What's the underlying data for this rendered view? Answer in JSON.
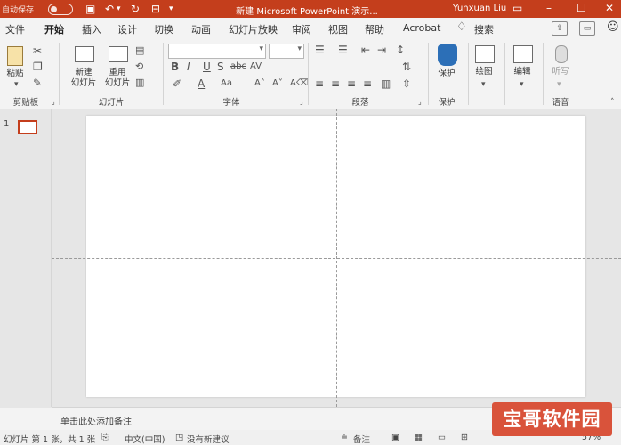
{
  "titlebar": {
    "autosave": "自动保存",
    "autosave_state": "关",
    "title": "新建 Microsoft PowerPoint 演示...",
    "user": "Yunxuan Liu"
  },
  "tabs": [
    "文件",
    "开始",
    "插入",
    "设计",
    "切换",
    "动画",
    "幻灯片放映",
    "审阅",
    "视图",
    "帮助",
    "Acrobat",
    "搜索"
  ],
  "active_tab": "开始",
  "ribbon": {
    "clipboard": {
      "paste": "粘贴",
      "label": "剪贴板"
    },
    "slides": {
      "new_slide": "新建\n幻灯片",
      "reuse": "重用\n幻灯片",
      "label": "幻灯片"
    },
    "font": {
      "label": "字体"
    },
    "paragraph": {
      "label": "段落"
    },
    "protect": {
      "button": "保护",
      "label": "保护"
    },
    "drawing": {
      "button": "绘图"
    },
    "editing": {
      "button": "编辑"
    },
    "voice": {
      "button": "听写",
      "label": "语音"
    }
  },
  "slide_pane": {
    "slide_number": "1"
  },
  "notes": {
    "placeholder": "单击此处添加备注"
  },
  "status": {
    "slide_info": "幻灯片 第 1 张，共 1 张",
    "language": "中文(中国)",
    "suggestions": "没有新建议",
    "notes_button": "备注",
    "zoom": "57%"
  },
  "watermark": "宝哥软件园",
  "colors": {
    "accent": "#c43e1c",
    "ribbon_bg": "#f3f3f3",
    "canvas_bg": "#e6e6e6"
  }
}
